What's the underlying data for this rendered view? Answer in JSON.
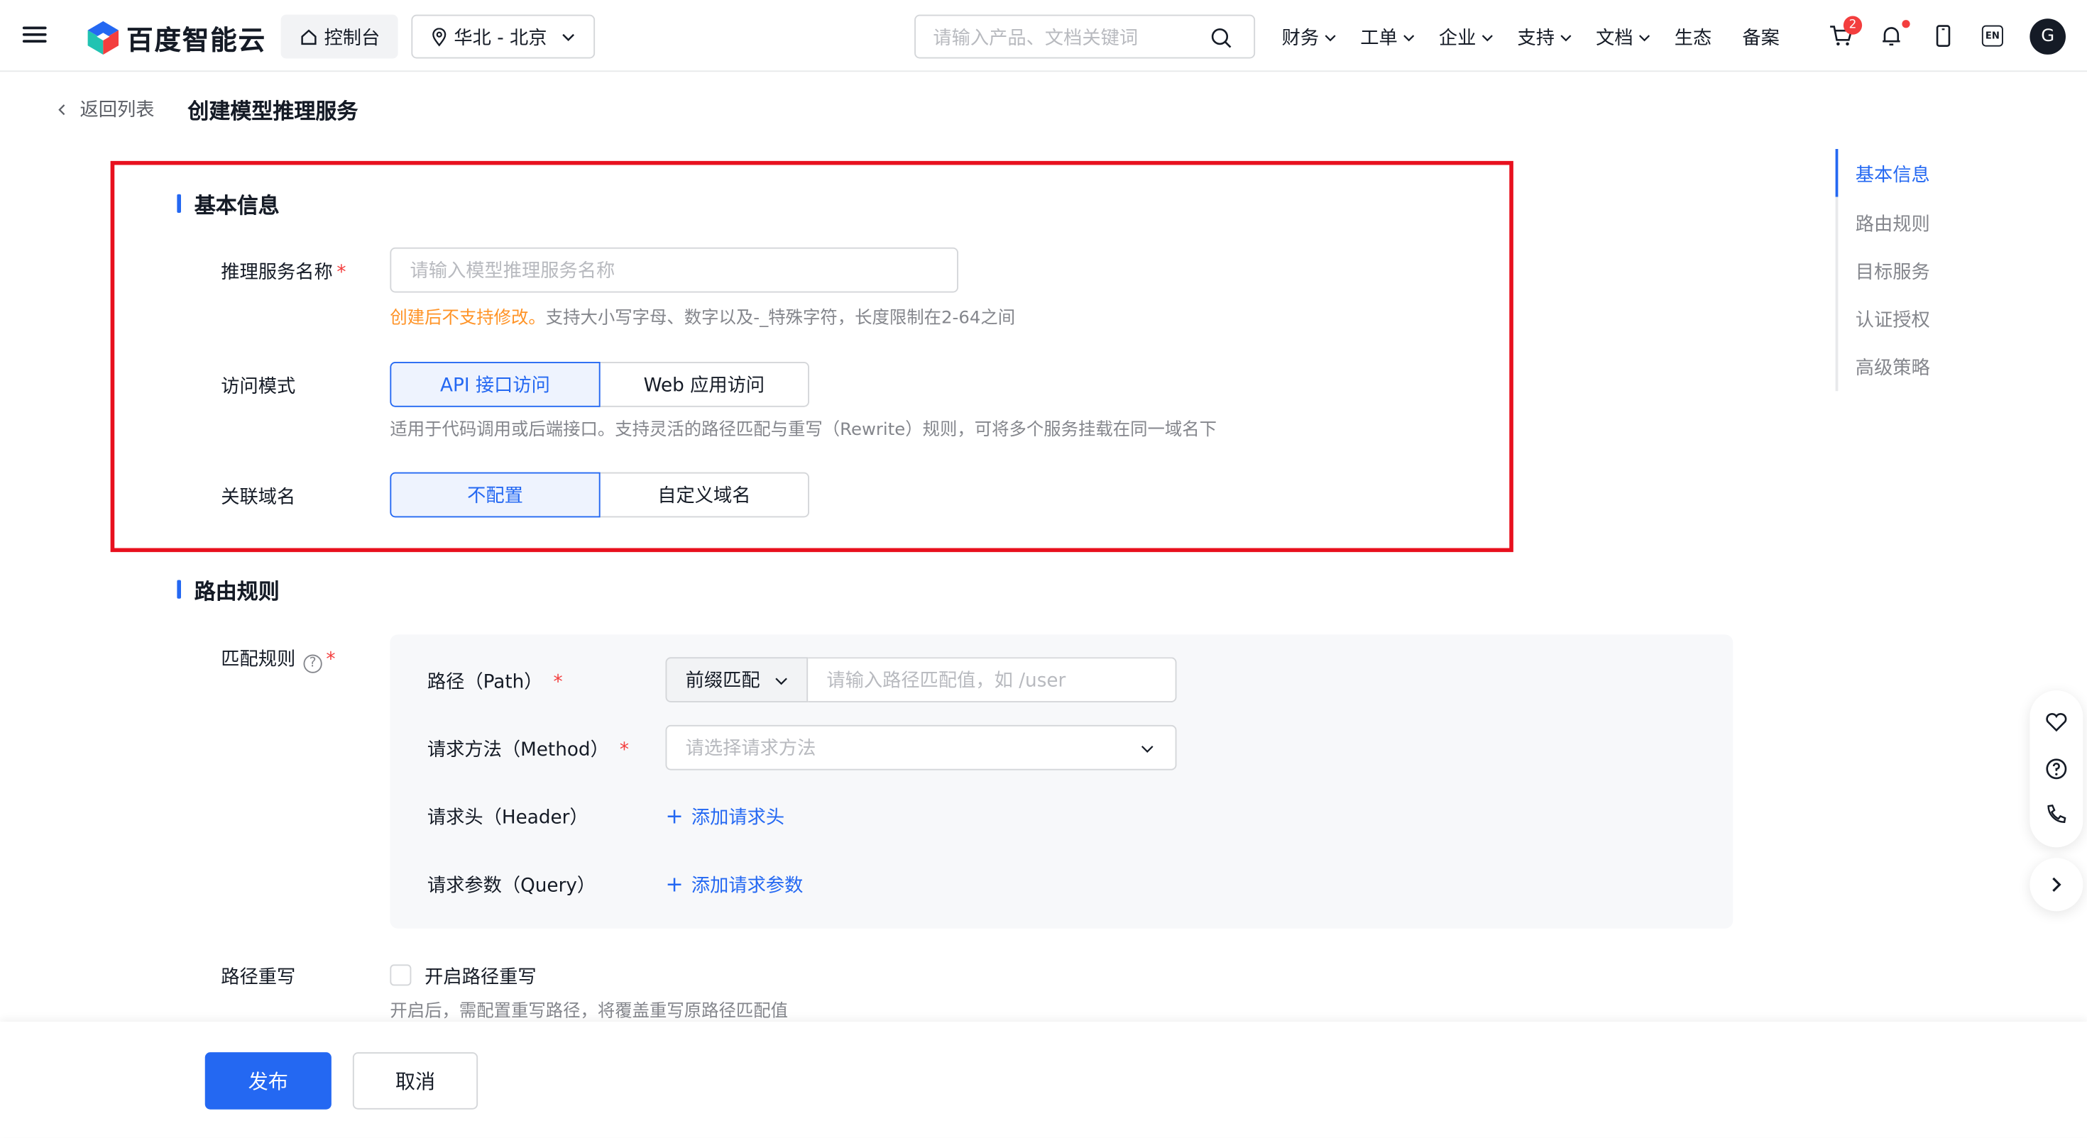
{
  "header": {
    "logo_text": "百度智能云",
    "console_label": "控制台",
    "region_label": "华北 - 北京",
    "search_placeholder": "请输入产品、文档关键词",
    "nav": [
      {
        "label": "财务",
        "dropdown": true
      },
      {
        "label": "工单",
        "dropdown": true
      },
      {
        "label": "企业",
        "dropdown": true
      },
      {
        "label": "支持",
        "dropdown": true
      },
      {
        "label": "文档",
        "dropdown": true
      },
      {
        "label": "生态",
        "dropdown": false
      },
      {
        "label": "备案",
        "dropdown": false
      }
    ],
    "cart_badge": "2",
    "lang_label": "EN",
    "avatar_letter": "G"
  },
  "breadcrumb": {
    "back_label": "返回列表",
    "title": "创建模型推理服务"
  },
  "basic_info": {
    "section_title": "基本信息",
    "name_label": "推理服务名称",
    "required_mark": "*",
    "name_placeholder": "请输入模型推理服务名称",
    "name_hint_warn": "创建后不支持修改。",
    "name_hint": "支持大小写字母、数字以及-_特殊字符，长度限制在2-64之间",
    "access_label": "访问模式",
    "access_options": [
      "API 接口访问",
      "Web 应用访问"
    ],
    "access_selected": "API 接口访问",
    "access_hint": "适用于代码调用或后端接口。支持灵活的路径匹配与重写（Rewrite）规则，可将多个服务挂载在同一域名下",
    "domain_label": "关联域名",
    "domain_options": [
      "不配置",
      "自定义域名"
    ],
    "domain_selected": "不配置"
  },
  "routing": {
    "section_title": "路由规则",
    "match_label": "匹配规则",
    "help_glyph": "?",
    "path_label": "路径（Path）",
    "path_match_type": "前缀匹配",
    "path_placeholder": "请输入路径匹配值，如 /user",
    "method_label": "请求方法（Method）",
    "method_placeholder": "请选择请求方法",
    "header_label": "请求头（Header）",
    "add_header": "添加请求头",
    "query_label": "请求参数（Query）",
    "add_query": "添加请求参数",
    "plus_glyph": "+",
    "rewrite_label": "路径重写",
    "rewrite_checkbox_label": "开启路径重写",
    "rewrite_checked": false,
    "rewrite_hint": "开启后，需配置重写路径，将覆盖重写原路径匹配值"
  },
  "footer": {
    "publish_label": "发布",
    "cancel_label": "取消"
  },
  "anchors": {
    "items": [
      "基本信息",
      "路由规则",
      "目标服务",
      "认证授权",
      "高级策略"
    ],
    "active": "基本信息"
  },
  "colors": {
    "primary": "#2468f2",
    "highlight_border": "#e8101e",
    "warn": "#ff9326",
    "required": "#f33e3e"
  },
  "icons": {
    "menu": "hamburger-icon",
    "console": "home-icon",
    "region": "location-pin-icon",
    "search": "search-icon",
    "cart": "cart-icon",
    "bell": "bell-icon",
    "phone": "mobile-icon",
    "float": [
      "heart-icon",
      "question-icon",
      "phone-call-icon",
      "chevron-right-icon"
    ]
  }
}
